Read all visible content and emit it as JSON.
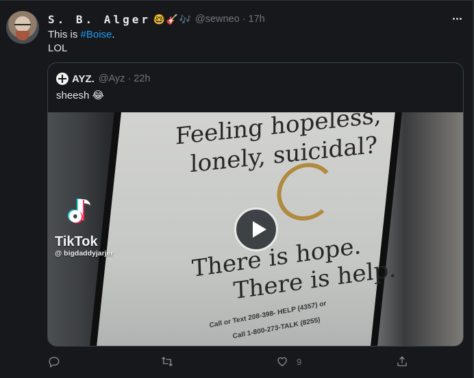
{
  "tweet": {
    "display_name": "S. B. Alger",
    "name_emojis": [
      "🤓",
      "🎸",
      "🎶"
    ],
    "handle": "@sewneo",
    "separator": "·",
    "time": "17h",
    "text_prefix": "This is ",
    "hashtag": "#Boise",
    "text_suffix": ".",
    "text_line2": "LOL"
  },
  "quote": {
    "name": "AYZ.",
    "handle": "@Ayz",
    "separator": "·",
    "time": "22h",
    "text": "sheesh 😂",
    "video": {
      "sign_lines": [
        "Feeling hopeless,",
        "lonely, suicidal?",
        "There is hope.",
        "There is help."
      ],
      "sign_small_lines": [
        "Call or Text 208-398- HELP (4357) or",
        "Call 1-800-273-TALK (8255)"
      ],
      "watermark_brand": "TikTok",
      "watermark_user": "@ bigdaddyjarjer"
    }
  },
  "actions": {
    "like_count": "9"
  }
}
